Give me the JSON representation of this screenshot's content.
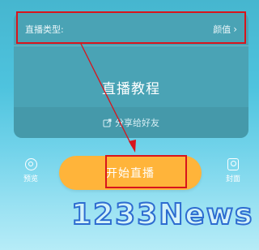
{
  "card": {
    "type_label": "直播类型:",
    "type_value": "颜值",
    "title": "直播教程",
    "share_label": "分享给好友"
  },
  "preview_button": {
    "label": "预览",
    "icon": "preview-icon"
  },
  "cover_button": {
    "label": "封面",
    "icon": "cover-icon"
  },
  "start_button": {
    "label": "开始直播"
  },
  "watermark": {
    "text": "1233News"
  },
  "colors": {
    "accent_orange": "#ffb43a",
    "highlight_red": "#d8141c",
    "card_bg": "#4aa3b5",
    "watermark_blue": "#2d6cd0"
  }
}
